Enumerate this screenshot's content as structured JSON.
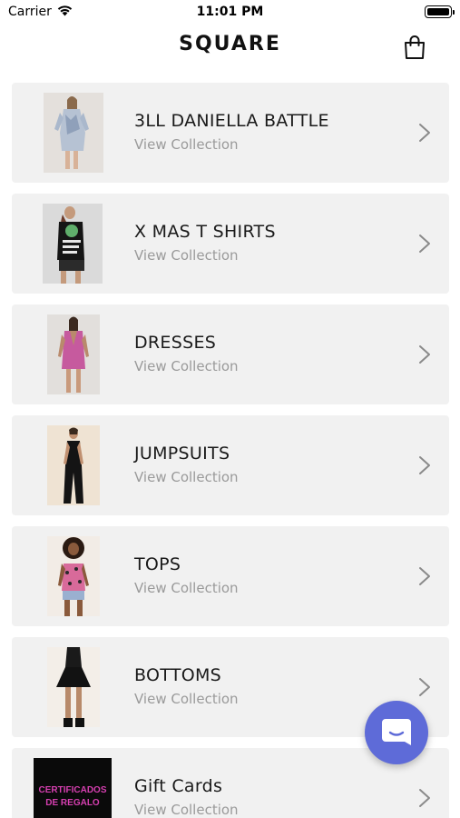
{
  "status_bar": {
    "carrier": "Carrier",
    "time": "11:01 PM",
    "battery_level": 1.0
  },
  "header": {
    "title": "SQUARE",
    "cart_icon": "shopping-bag-icon"
  },
  "collections": [
    {
      "title": "3LL DANIELLA BATTLE",
      "subtitle": "View Collection",
      "image": "sequin-shirt-dress-photo"
    },
    {
      "title": "X MAS T SHIRTS",
      "subtitle": "View Collection",
      "image": "graphic-tshirt-photo"
    },
    {
      "title": "DRESSES",
      "subtitle": "View Collection",
      "image": "pink-sequin-dress-photo"
    },
    {
      "title": "JUMPSUITS",
      "subtitle": "View Collection",
      "image": "black-jumpsuit-photo"
    },
    {
      "title": "TOPS",
      "subtitle": "View Collection",
      "image": "floral-cami-top-photo"
    },
    {
      "title": "BOTTOMS",
      "subtitle": "View Collection",
      "image": "black-skater-skirt-photo"
    },
    {
      "title": "Gift Cards",
      "subtitle": "View Collection",
      "image": "gift-card-image",
      "image_text": "CERTIFICADOS DE REGALO"
    }
  ],
  "chat_button": {
    "icon": "chat-bubble-icon"
  },
  "colors": {
    "card_background": "#f1f1f1",
    "subtitle": "#9a9a9a",
    "chat_button": "#5e6bd8",
    "gift_card_text": "#d63fb0"
  }
}
